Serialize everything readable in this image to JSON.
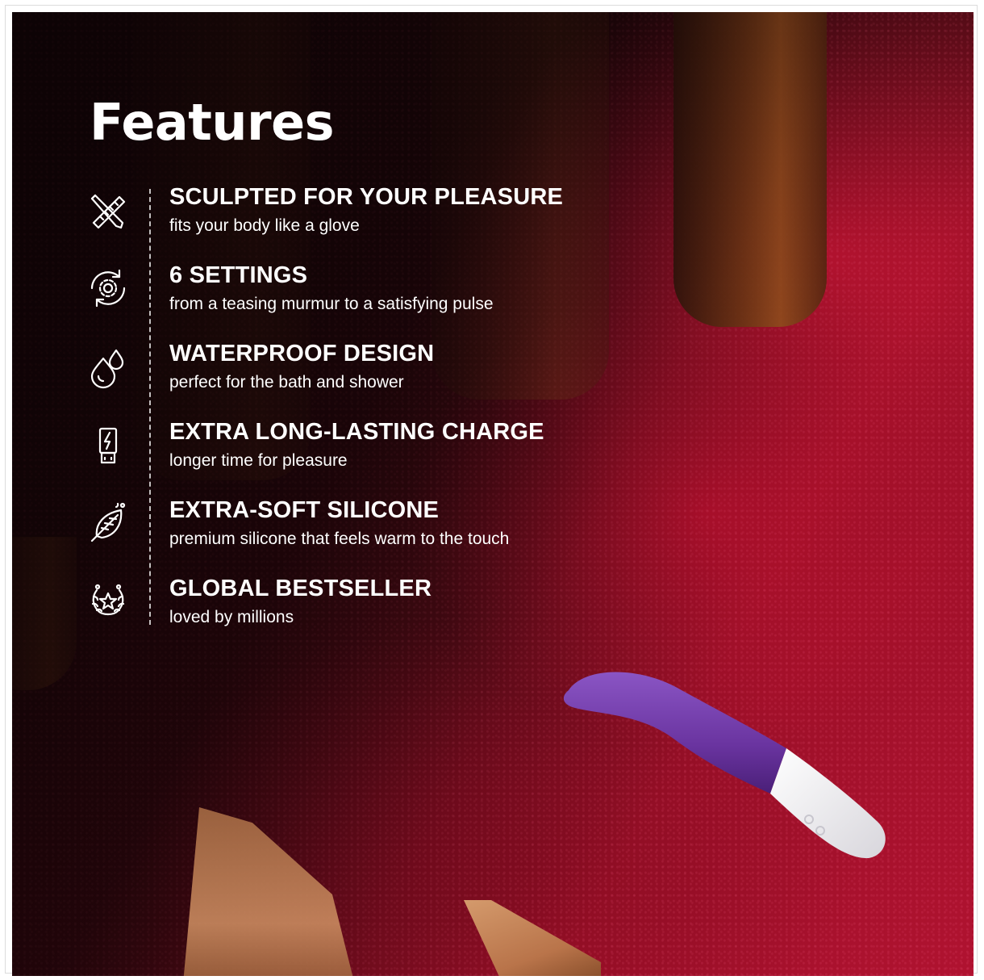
{
  "title": "Features",
  "features": [
    {
      "icon": "ruler-pencil-icon",
      "heading": "SCULPTED FOR YOUR PLEASURE",
      "sub": "fits your body like a glove"
    },
    {
      "icon": "gear-cycle-icon",
      "heading": "6 SETTINGS",
      "sub": "from a teasing murmur to a satisfying pulse"
    },
    {
      "icon": "water-drops-icon",
      "heading": "WATERPROOF DESIGN",
      "sub": "perfect for the bath and shower"
    },
    {
      "icon": "usb-charge-icon",
      "heading": "EXTRA LONG-LASTING CHARGE",
      "sub": "longer time for pleasure"
    },
    {
      "icon": "feather-icon",
      "heading": "EXTRA-SOFT SILICONE",
      "sub": "premium silicone that feels warm to the touch"
    },
    {
      "icon": "laurel-star-icon",
      "heading": "GLOBAL BESTSELLER",
      "sub": "loved by millions"
    }
  ],
  "colors": {
    "carpet": "#b01230",
    "shadow": "#1c0709",
    "product_purple": "#6e3aa0",
    "product_white": "#f2f0f4",
    "text": "#ffffff"
  }
}
